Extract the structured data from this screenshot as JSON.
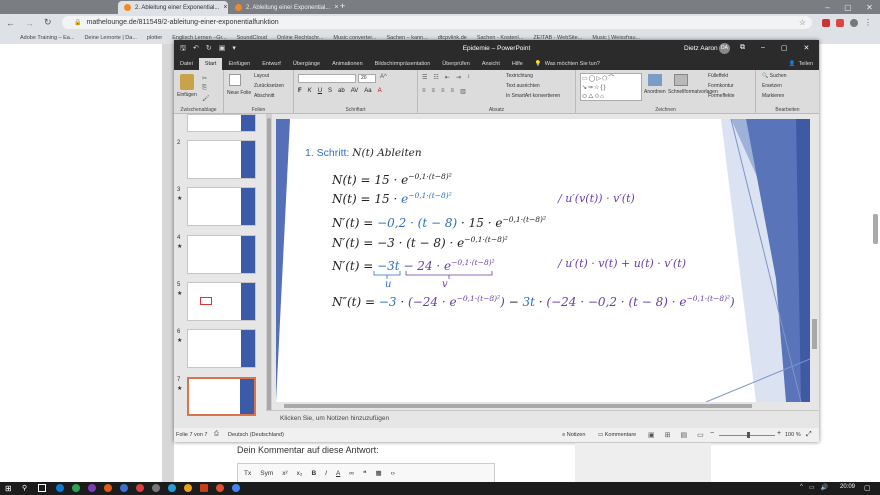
{
  "browser": {
    "tabs": [
      {
        "label": "2. Ableitung einer Exponential..."
      },
      {
        "label": "2. Ableitung einer Exponential..."
      }
    ],
    "new_tab": "+",
    "url": "mathelounge.de/811549/2-ableitung-einer-exponentialfunktion",
    "bookmarks": [
      "Adobe Training – Ea...",
      "Deine Lernorte | Da...",
      "plotter",
      "Englisch Lernen –Gr...",
      "SoundCloud",
      "Online Rechtschr...",
      "Music converter...",
      "Sachen – kann...",
      "dtcpvlink.de",
      "Sachen - Kostenl...",
      "ZEITAB - WebSite...",
      "Music | Weissfrau..."
    ]
  },
  "pp": {
    "title": "Epidemie  –  PowerPoint",
    "user": "Dietz Aaron",
    "avatar": "DA",
    "menus": [
      "Datei",
      "Start",
      "Einfügen",
      "Entwurf",
      "Übergänge",
      "Animationen",
      "Bildschirmpräsentation",
      "Überprüfen",
      "Ansicht",
      "Hilfe",
      "Was möchten Sie tun?"
    ],
    "share": "Teilen",
    "ribbon": {
      "groups": [
        "Zwischenablage",
        "Folien",
        "Schriftart",
        "Absatz",
        "Zeichnen",
        "Bearbeiten"
      ],
      "paste": "Einfügen",
      "new_slide": "Neue Folie",
      "layout": "Layout",
      "reset": "Zurücksetzen",
      "section": "Abschnitt",
      "font_size": "20",
      "text_direction": "Textrichtung",
      "align_text": "Text ausrichten",
      "smartart": "In SmartArt konvertieren",
      "arrange": "Anordnen",
      "quick_styles": "Schnellformatvorlagen",
      "fill": "Fülleffekt",
      "outline": "Formkontur",
      "effects": "Formeffekte",
      "find": "Suchen",
      "replace": "Ersetzen",
      "select": "Markieren"
    },
    "slide_numbers": [
      "2",
      "3",
      "4",
      "5",
      "6",
      "7"
    ],
    "star": "★",
    "slide": {
      "heading_prefix": "1. Schritt:",
      "heading_rest": "N(t) Ableiten",
      "rule1": "/ u′(v(t)) · v′(t)",
      "rule2": "/ u′(t) · v(t) + u(t) · v′(t)",
      "label_u": "u",
      "label_v": "v"
    },
    "notes": "Klicken Sie, um Notizen hinzuzufügen",
    "status": {
      "slide_count": "Folie 7 von 7",
      "language": "Deutsch (Deutschland)",
      "notes_btn": "Notizen",
      "comments_btn": "Kommentare",
      "zoom": "100 %"
    }
  },
  "page": {
    "comment_label": "Dein Kommentar auf diese Antwort:"
  },
  "taskbar": {
    "time": "20:09"
  },
  "colors": {
    "accent": "#b7472a",
    "formula_blue": "#2e6fc3",
    "formula_purple": "#6a3cab"
  }
}
